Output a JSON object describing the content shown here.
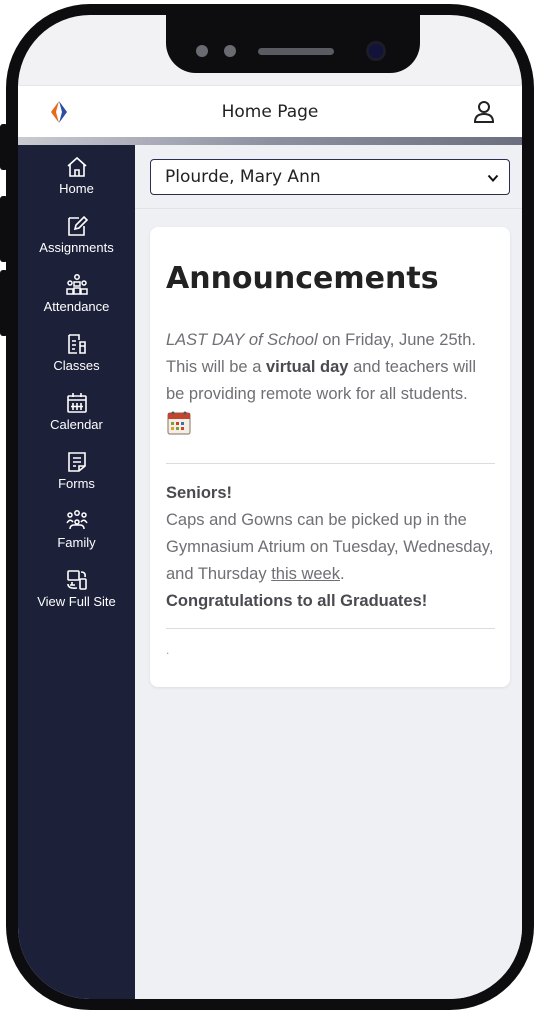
{
  "header": {
    "title": "Home Page"
  },
  "nav": {
    "items": [
      {
        "label": "Home",
        "icon": "home-icon"
      },
      {
        "label": "Assignments",
        "icon": "assignments-icon"
      },
      {
        "label": "Attendance",
        "icon": "attendance-icon"
      },
      {
        "label": "Classes",
        "icon": "classes-icon"
      },
      {
        "label": "Calendar",
        "icon": "calendar-icon"
      },
      {
        "label": "Forms",
        "icon": "forms-icon"
      },
      {
        "label": "Family",
        "icon": "family-icon"
      },
      {
        "label": "View Full Site",
        "icon": "view-full-site-icon"
      }
    ]
  },
  "student_select": {
    "selected": "Plourde, Mary Ann"
  },
  "announcements": {
    "heading": "Announcements",
    "items": [
      {
        "italic_lead": "LAST DAY of School",
        "text_1": " on Friday, June 25th. This will be a ",
        "bold_1": "virtual day",
        "text_2": " and teachers will be providing remote work for all students."
      },
      {
        "title": "Seniors!",
        "text_1": "Caps and Gowns can be picked up in the Gymnasium Atrium on Tuesday, Wednesday, and Thursday ",
        "underline": "this week",
        "text_2": ".",
        "bold_closing": "Congratulations to all Graduates!"
      },
      {
        "text": "."
      }
    ]
  },
  "colors": {
    "sidebar": "#1c2039",
    "accent_logo_orange": "#e8681e",
    "accent_logo_blue": "#2a4fa0",
    "select_border": "#2a2e52",
    "background": "#eef0f4"
  }
}
